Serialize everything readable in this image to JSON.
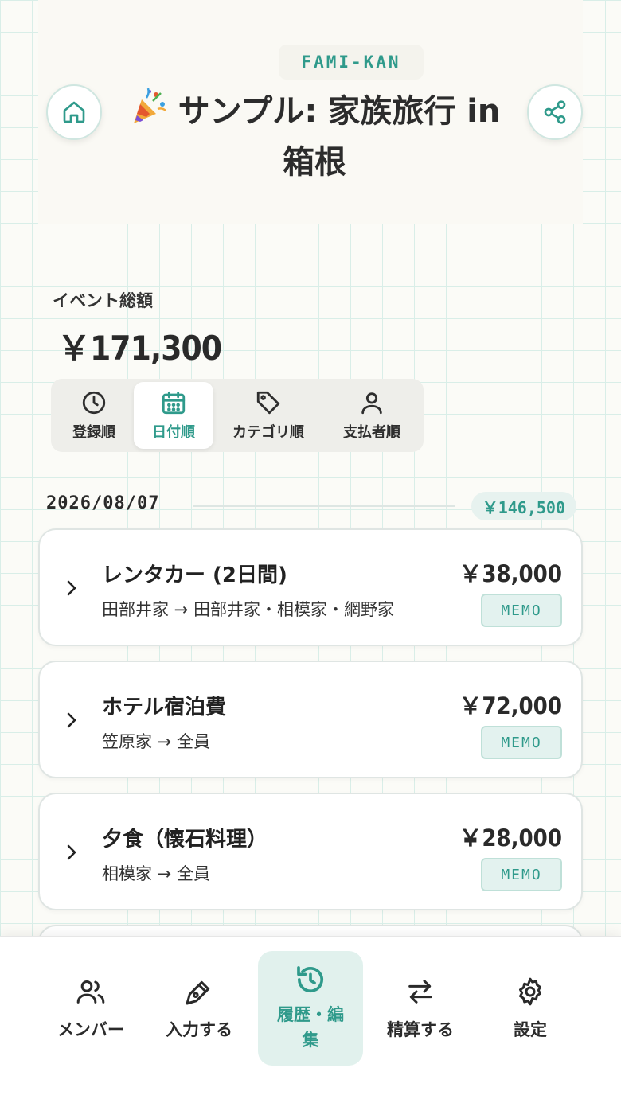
{
  "app": {
    "brand": "FAMI-KAN"
  },
  "header": {
    "title": "サンプル: 家族旅行 in 箱根",
    "home_icon": "home-icon",
    "share_icon": "share-icon",
    "title_icon": "party-popper-icon"
  },
  "summary": {
    "label": "イベント総額",
    "total": "￥171,300"
  },
  "sort_tabs": [
    {
      "label": "登録順",
      "icon": "clock-icon",
      "active": false
    },
    {
      "label": "日付順",
      "icon": "calendar-icon",
      "active": true
    },
    {
      "label": "カテゴリ順",
      "icon": "tag-icon",
      "active": false
    },
    {
      "label": "支払者順",
      "icon": "person-icon",
      "active": false
    }
  ],
  "groups": [
    {
      "date": "2026/08/07",
      "subtotal": "￥146,500",
      "items": [
        {
          "name": "レンタカー (2日間)",
          "flow": "田部井家 → 田部井家・相模家・網野家",
          "amount": "￥38,000",
          "memo": "MEMO"
        },
        {
          "name": "ホテル宿泊費",
          "flow": "笠原家 → 全員",
          "amount": "￥72,000",
          "memo": "MEMO"
        },
        {
          "name": "夕食（懐石料理）",
          "flow": "相模家 → 全員",
          "amount": "￥28,000",
          "memo": "MEMO"
        }
      ]
    }
  ],
  "bottom_nav": [
    {
      "label": "メンバー",
      "icon": "users-icon",
      "active": false
    },
    {
      "label": "入力する",
      "icon": "pen-icon",
      "active": false
    },
    {
      "label": "履歴・編集",
      "icon": "history-icon",
      "active": true
    },
    {
      "label": "精算する",
      "icon": "swap-arrows-icon",
      "active": false
    },
    {
      "label": "設定",
      "icon": "gear-icon",
      "active": false
    }
  ],
  "colors": {
    "accent": "#2f9a8b",
    "accent_bg": "#e1f1ed",
    "grid": "#d9eee8",
    "text": "#2a2a2a"
  }
}
